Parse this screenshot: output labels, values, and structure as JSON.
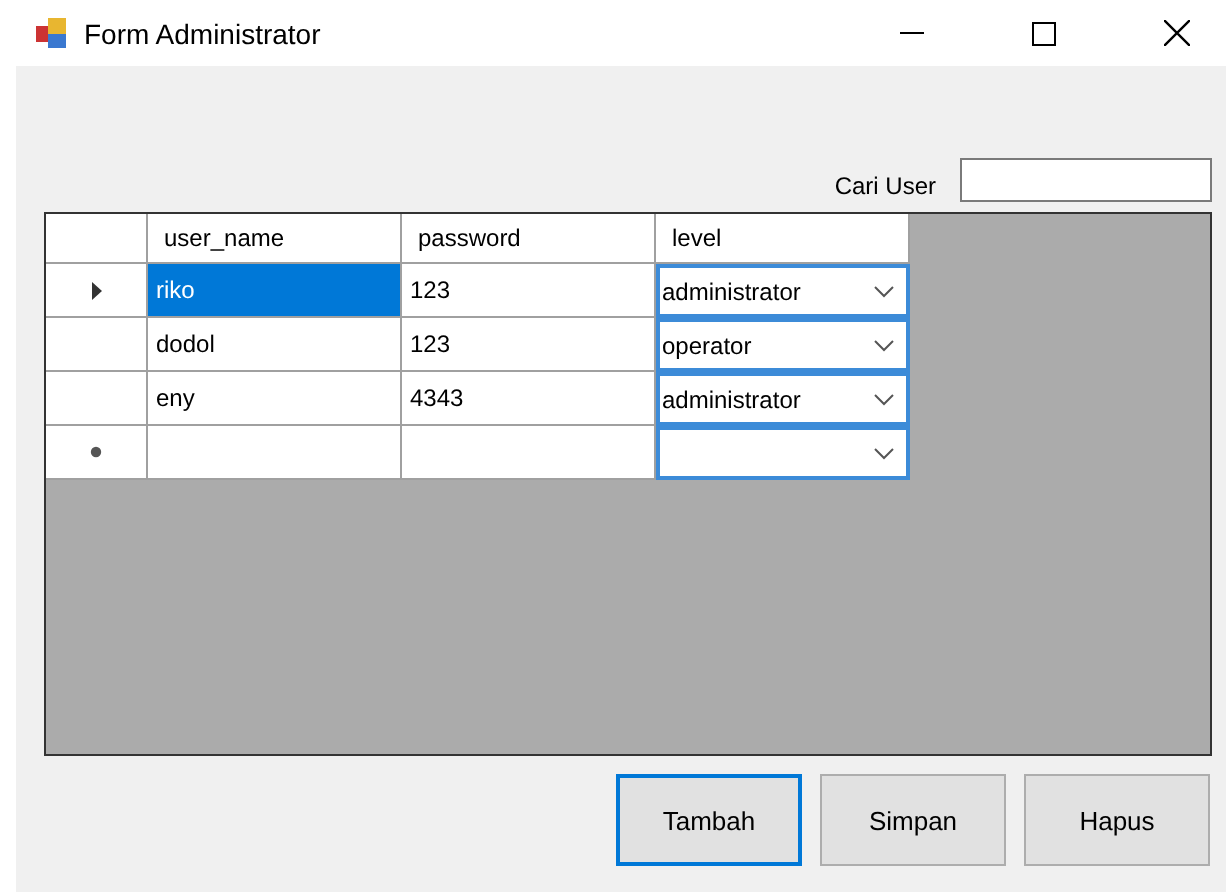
{
  "window": {
    "title": "Form Administrator"
  },
  "search": {
    "label": "Cari User"
  },
  "table": {
    "columns": [
      "user_name",
      "password",
      "level"
    ],
    "rows": [
      {
        "kind": "data",
        "current": true,
        "cells": [
          {
            "text": "riko",
            "selected": true
          },
          {
            "text": "123",
            "selected": false
          },
          {
            "text": "administrator",
            "selected": false
          }
        ]
      },
      {
        "kind": "data",
        "current": false,
        "cells": [
          {
            "text": "dodol",
            "selected": false
          },
          {
            "text": "123",
            "selected": false
          },
          {
            "text": "operator",
            "selected": false
          }
        ]
      },
      {
        "kind": "data",
        "current": false,
        "cells": [
          {
            "text": "eny",
            "selected": false
          },
          {
            "text": "4343",
            "selected": false
          },
          {
            "text": "administrator",
            "selected": false
          }
        ]
      },
      {
        "kind": "new",
        "current": false,
        "cells": [
          {
            "text": "",
            "selected": false
          },
          {
            "text": "",
            "selected": false
          },
          {
            "text": "",
            "selected": false
          }
        ]
      }
    ]
  },
  "buttons": [
    {
      "label": "Tambah",
      "focused": true
    },
    {
      "label": "Simpan",
      "focused": false
    },
    {
      "label": "Hapus",
      "focused": false
    }
  ]
}
